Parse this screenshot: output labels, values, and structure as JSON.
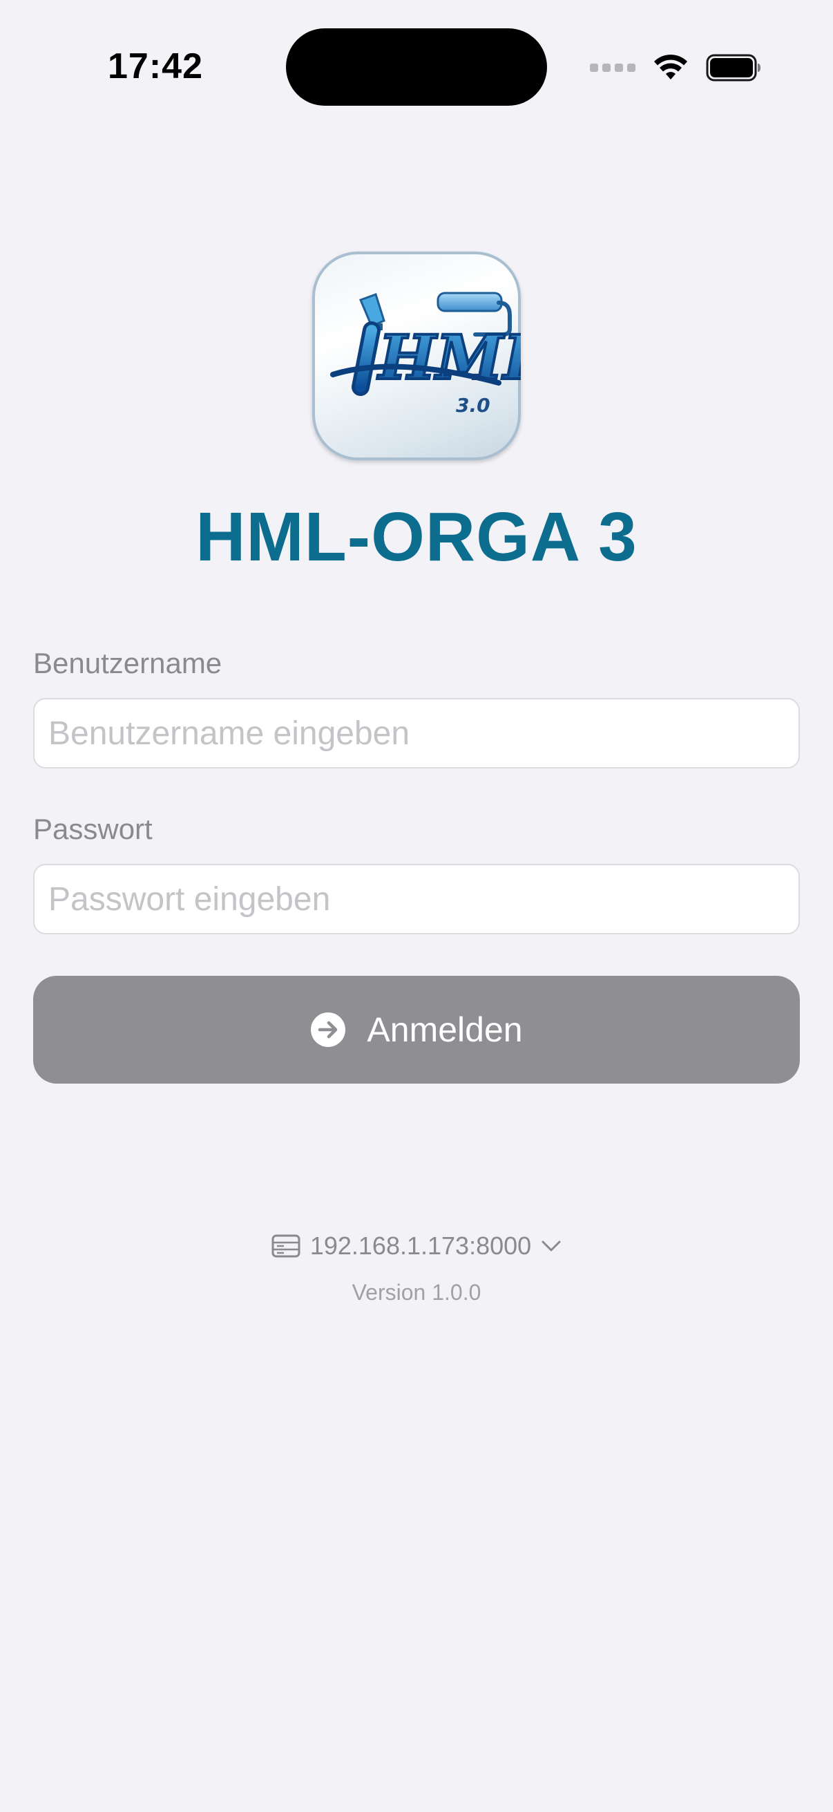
{
  "status_bar": {
    "time": "17:42"
  },
  "app": {
    "title": "HML-ORGA 3",
    "logo_text": "HML",
    "logo_version": "3.0"
  },
  "form": {
    "username_label": "Benutzername",
    "username_placeholder": "Benutzername eingeben",
    "username_value": "",
    "password_label": "Passwort",
    "password_placeholder": "Passwort eingeben",
    "password_value": "",
    "login_label": "Anmelden"
  },
  "footer": {
    "server_address": "192.168.1.173:8000",
    "version": "Version 1.0.0"
  },
  "icons": {
    "server": "server-icon",
    "chevron": "chevron-down-icon",
    "login": "arrow-right-circle-icon"
  },
  "colors": {
    "accent": "#0d6d8f",
    "button_disabled": "#8e8e93",
    "background": "#f2f2f7"
  }
}
